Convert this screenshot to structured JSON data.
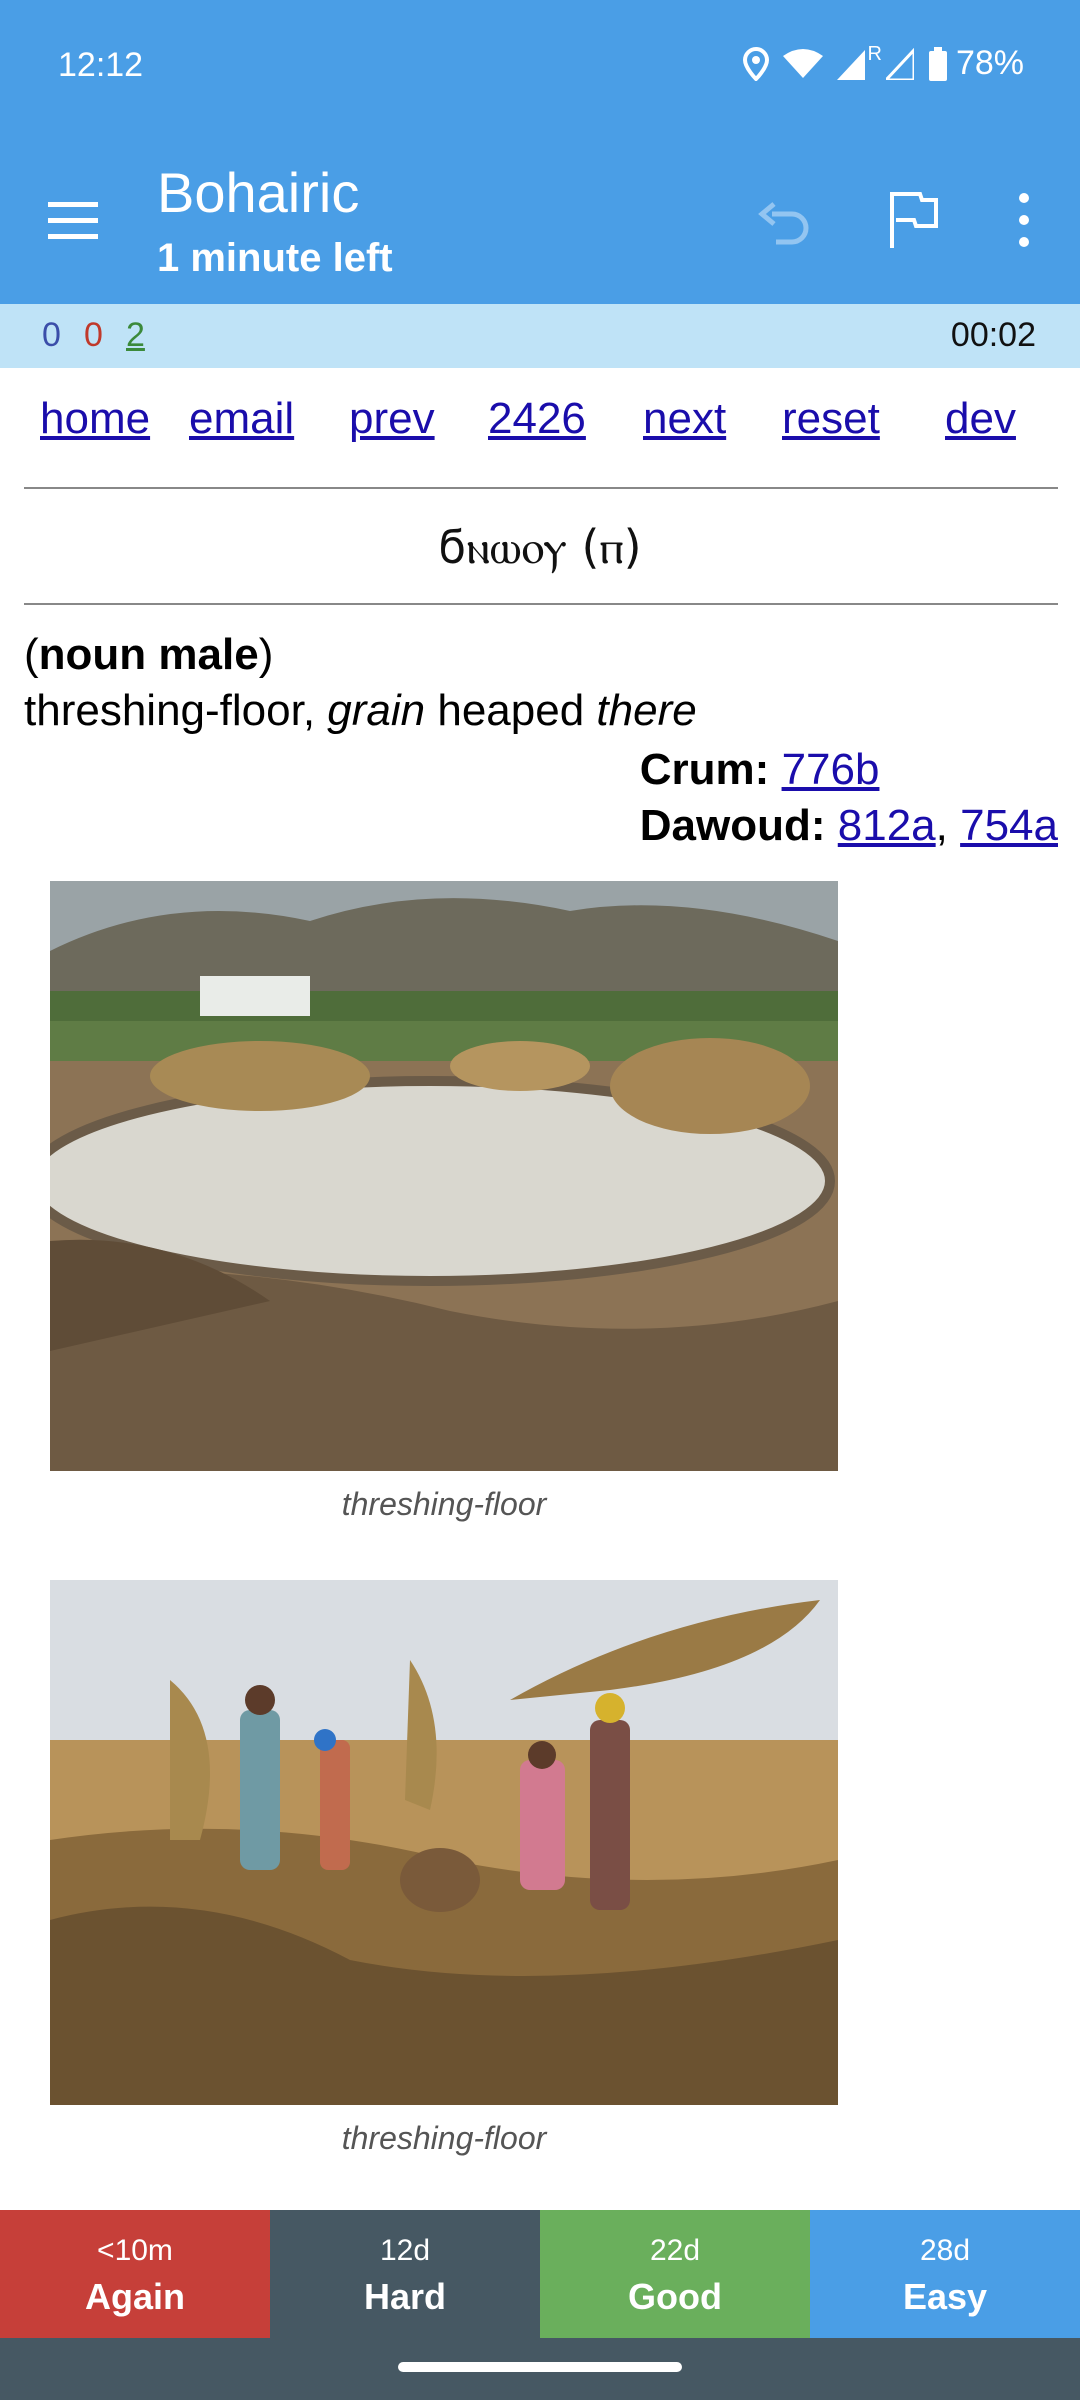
{
  "status": {
    "time": "12:12",
    "battery": "78%",
    "roaming": "R"
  },
  "appbar": {
    "title": "Bohairic",
    "subtitle": "1 minute left"
  },
  "counts": {
    "new": "0",
    "learn": "0",
    "review": "2",
    "timer": "00:02"
  },
  "nav": [
    "home",
    "email",
    "prev",
    "2426",
    "next",
    "reset",
    "dev"
  ],
  "entry": {
    "headword": "ϭⲛⲱⲟⲩ (ⲡ)",
    "pos": "noun male",
    "def_part1": "threshing-floor, ",
    "def_grain": "grain",
    "def_part2": " heaped ",
    "def_there": "there",
    "crum_label": "Crum:",
    "crum_ref": "776b",
    "dawoud_label": "Dawoud:",
    "dawoud_ref1": "812a",
    "dawoud_ref2": "754a",
    "captions": [
      "threshing-floor",
      "threshing-floor"
    ]
  },
  "answers": [
    {
      "interval": "<10m",
      "label": "Again"
    },
    {
      "interval": "12d",
      "label": "Hard"
    },
    {
      "interval": "22d",
      "label": "Good"
    },
    {
      "interval": "28d",
      "label": "Easy"
    }
  ],
  "colors": {
    "primary": "#4a9ee6",
    "again": "#c63f39",
    "hard": "#465863",
    "good": "#6aaf5c",
    "easy": "#4a9ee6",
    "link": "#1a0dab"
  }
}
